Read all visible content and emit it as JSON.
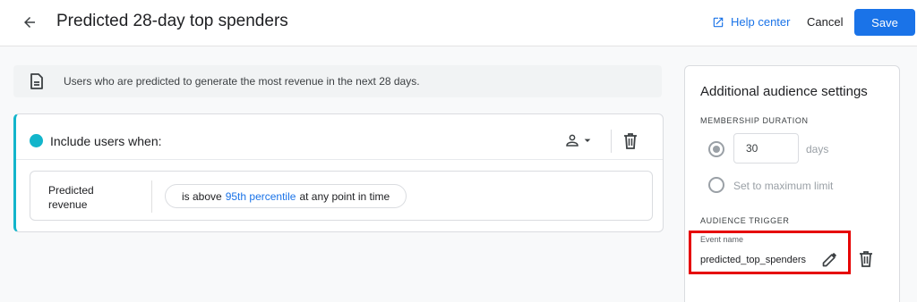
{
  "header": {
    "back_icon": "arrow-back-icon",
    "title": "Predicted 28-day top spenders",
    "help_label": "Help center",
    "help_icon": "open-in-new-icon",
    "cancel_label": "Cancel",
    "save_label": "Save",
    "accent_color": "#1a73e8"
  },
  "banner": {
    "icon": "document-icon",
    "text": "Users who are predicted to generate the most revenue in the next 28 days."
  },
  "condition_group": {
    "accent_color": "#12b5cb",
    "title": "Include users when:",
    "scope_icon": "person-icon",
    "dropdown_icon": "arrow-drop-down-icon",
    "delete_icon": "trash-icon",
    "condition": {
      "label_line1": "Predicted",
      "label_line2": "revenue",
      "operator": "is above",
      "value": "95th percentile",
      "suffix": "at any point in time"
    }
  },
  "settings": {
    "title": "Additional audience settings",
    "membership_label": "MEMBERSHIP DURATION",
    "duration_value": "30",
    "duration_unit": "days",
    "max_limit_label": "Set to maximum limit",
    "selected_option": "days",
    "trigger_label": "AUDIENCE TRIGGER",
    "event_name_label": "Event name",
    "event_name_value": "predicted_top_spenders",
    "edit_icon": "pencil-icon",
    "delete_icon": "trash-icon",
    "highlight_color": "#e60000"
  }
}
